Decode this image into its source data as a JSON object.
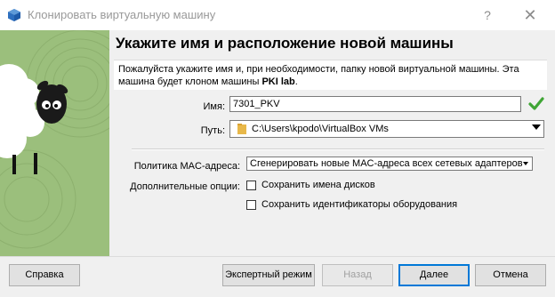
{
  "window": {
    "title": "Клонировать виртуальную машину",
    "help_glyph": "?",
    "close_glyph": "✕"
  },
  "header": {
    "title": "Укажите имя и расположение новой машины"
  },
  "description": {
    "text": "Пожалуйста укажите имя и, при необходимости, папку новой виртуальной машины. Эта машина будет клоном машины ",
    "machine": "PKI lab",
    "end": "."
  },
  "form": {
    "name_label": "Имя:",
    "name_value": "7301_PKV",
    "path_label": "Путь:",
    "path_value": "C:\\Users\\kpodo\\VirtualBox VMs",
    "mac_label": "Политика MAC-адреса:",
    "mac_value": "Сгенерировать новые MAC-адреса всех сетевых адаптеров",
    "options_label": "Дополнительные опции:",
    "keep_disk_names": "Сохранить имена дисков",
    "keep_hw_uuids": "Сохранить идентификаторы оборудования"
  },
  "buttons": {
    "help": "Справка",
    "expert": "Экспертный режим",
    "back": "Назад",
    "next": "Далее",
    "cancel": "Отмена"
  },
  "colors": {
    "accent": "#0078d7",
    "sidebar_bg": "#9bbf7c",
    "valid_check": "#3fa535"
  }
}
